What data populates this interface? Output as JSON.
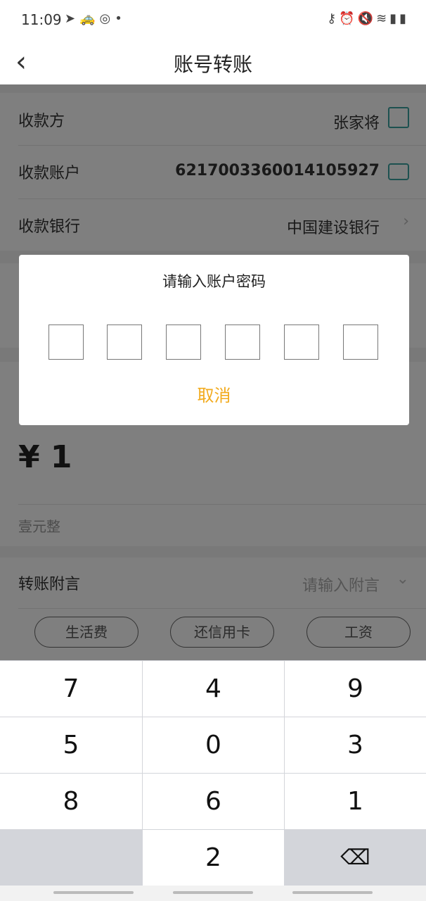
{
  "status_bar": {
    "time": "11:09",
    "left_icons": [
      "send-icon",
      "taxi-icon",
      "instagram-icon",
      "dot-icon"
    ],
    "right_icons": [
      "key-icon",
      "alarm-icon",
      "mute-icon",
      "wifi-icon",
      "signal-icon",
      "battery-icon"
    ]
  },
  "nav": {
    "title": "账号转账"
  },
  "payee": {
    "label": "收款方",
    "value": "张家将"
  },
  "account": {
    "label": "收款账户",
    "value": "6217003360014105927"
  },
  "bank": {
    "label": "收款银行",
    "value": "中国建设银行"
  },
  "amount": {
    "value": "¥ 1",
    "in_words": "壹元整"
  },
  "remark": {
    "label": "转账附言",
    "placeholder": "请输入附言",
    "chips": [
      "生活费",
      "还信用卡",
      "工资"
    ]
  },
  "dialog": {
    "title": "请输入账户密码",
    "cancel": "取消",
    "pin_length": 6
  },
  "keypad": {
    "rows": [
      [
        "7",
        "4",
        "9"
      ],
      [
        "5",
        "0",
        "3"
      ],
      [
        "8",
        "6",
        "1"
      ],
      [
        "",
        "2",
        "⌫"
      ]
    ]
  },
  "colors": {
    "accent": "#f2ab1e",
    "icon_green": "#3aa3a0",
    "overlay": "rgba(0,0,0,0.5)"
  }
}
